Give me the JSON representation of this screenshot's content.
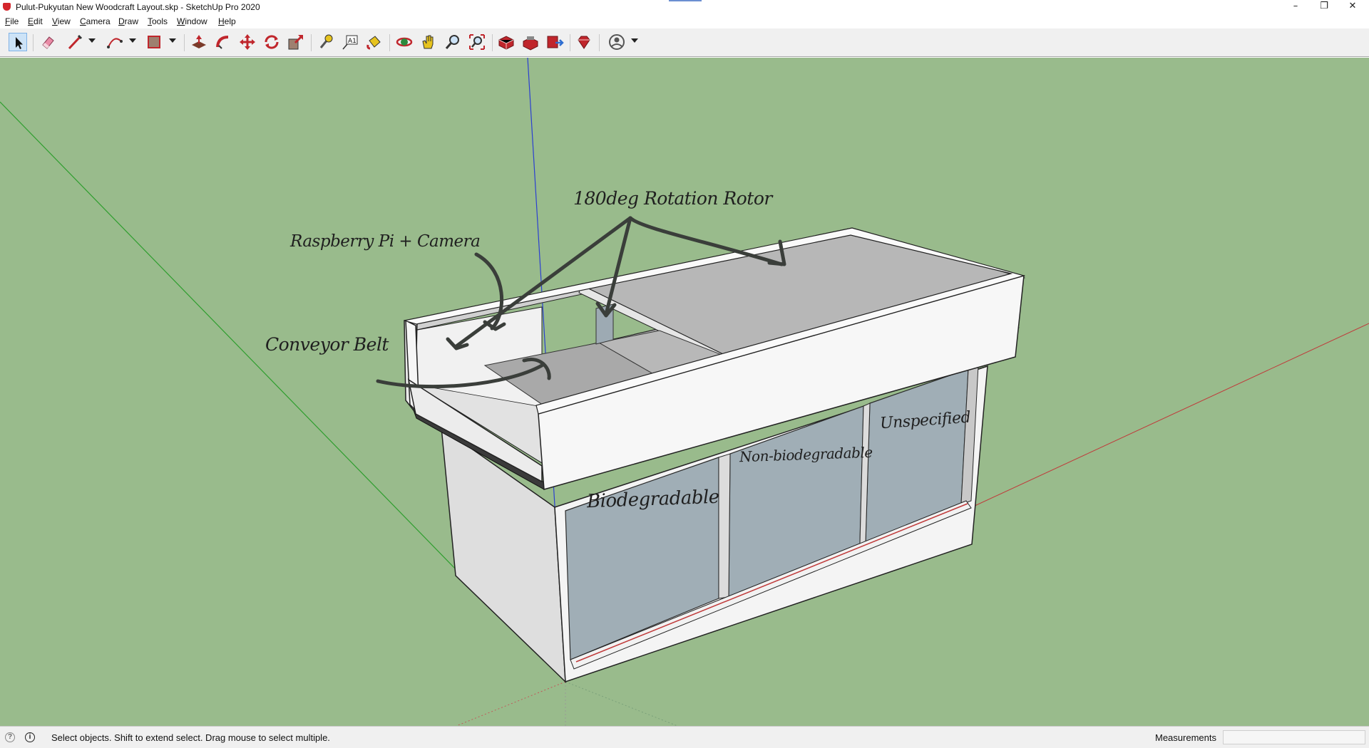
{
  "window": {
    "title": "Pulut-Pukyutan New Woodcraft Layout.skp - SketchUp Pro 2020",
    "minimize_glyph": "–",
    "restore_glyph": "❐",
    "close_glyph": "✕"
  },
  "menu": {
    "items": [
      {
        "label": "File",
        "key": "F",
        "rest": "ile"
      },
      {
        "label": "Edit",
        "key": "E",
        "rest": "dit"
      },
      {
        "label": "View",
        "key": "V",
        "rest": "iew"
      },
      {
        "label": "Camera",
        "key": "C",
        "rest": "amera"
      },
      {
        "label": "Draw",
        "key": "D",
        "rest": "raw"
      },
      {
        "label": "Tools",
        "key": "T",
        "rest": "ools"
      },
      {
        "label": "Window",
        "key": "W",
        "rest": "indow"
      },
      {
        "label": "Help",
        "key": "H",
        "rest": "elp"
      }
    ]
  },
  "toolbar": {
    "tools": [
      "select",
      "eraser",
      "line",
      "arc",
      "rectangle",
      "push-pull",
      "follow-me",
      "move",
      "rotate",
      "scale",
      "tape-measure",
      "text",
      "paint-bucket",
      "orbit",
      "pan",
      "zoom",
      "zoom-extents",
      "3d-warehouse",
      "extension-warehouse",
      "layout",
      "extension-manager",
      "account"
    ],
    "active_tool": "select"
  },
  "viewport": {
    "background_color": "#99bb8c",
    "annotations": {
      "rotor": "180deg Rotation Rotor",
      "raspberry": "Raspberry Pi + Camera",
      "conveyor": "Conveyor Belt",
      "biodegradable": "Biodegradable",
      "nonbio": "Non-biodegradable",
      "unspecified": "Unspecified"
    }
  },
  "status": {
    "message": "Select objects. Shift to extend select. Drag mouse to select multiple.",
    "measurements_label": "Measurements",
    "measurements_value": ""
  }
}
